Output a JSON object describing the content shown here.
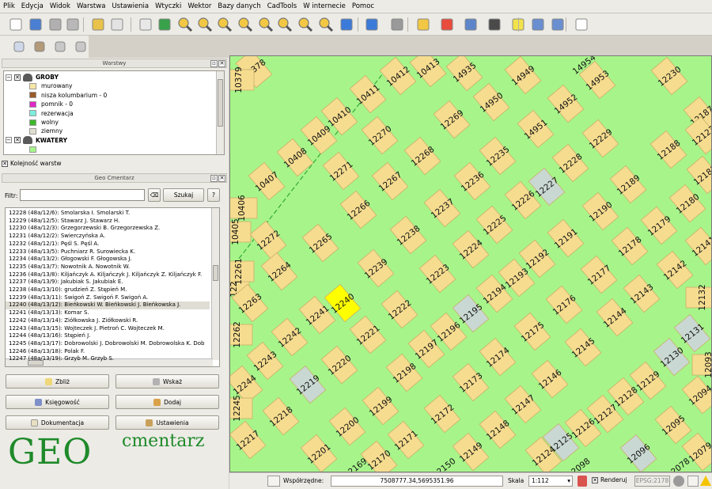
{
  "menu": [
    "Plik",
    "Edycja",
    "Widok",
    "Warstwa",
    "Ustawienia",
    "Wtyczki",
    "Wektor",
    "Bazy danych",
    "CadTools",
    "W internecie",
    "Pomoc"
  ],
  "toolbar": {
    "icons": [
      "new-file-icon",
      "open-project-icon",
      "save-icon",
      "save-as-icon",
      "print-composer-icon",
      "print-icon",
      "pan-hand-icon",
      "pan-to-selection-icon",
      "zoom-in-icon",
      "zoom-out-icon",
      "zoom-native-icon",
      "zoom-full-icon",
      "zoom-layer-icon",
      "zoom-selection-icon",
      "zoom-last-icon",
      "zoom-next-icon",
      "refresh-icon",
      "identify-icon",
      "action-gear-icon",
      "select-features-icon",
      "deselect-icon",
      "attribute-table-icon",
      "measure-icon",
      "map-tips-icon",
      "new-bookmark-icon",
      "show-bookmarks-icon",
      "text-annotation-icon"
    ],
    "row2_icons": [
      "label-abc-icon",
      "label-pin-icon",
      "label-pin-alt-icon",
      "label-move-icon"
    ]
  },
  "layers_panel": {
    "title": "Warstwy",
    "items": [
      {
        "type": "group",
        "label": "GROBY",
        "checked": true
      },
      {
        "type": "class",
        "label": "murowany",
        "color": "#f7e7a5"
      },
      {
        "type": "class",
        "label": "nisza kolumbarium - 0",
        "color": "#9b5a2a"
      },
      {
        "type": "class",
        "label": "pomnik - 0",
        "color": "#e026c6"
      },
      {
        "type": "class",
        "label": "rezerwacja",
        "color": "#7deedd"
      },
      {
        "type": "class",
        "label": "wolny",
        "color": "#3db82b"
      },
      {
        "type": "class",
        "label": "ziemny",
        "color": "#e0dfcf"
      },
      {
        "type": "group",
        "label": "KWATERY",
        "checked": true
      },
      {
        "type": "class",
        "label": "",
        "color": "#a7f58a"
      }
    ],
    "order_checkbox": "Kolejność warstw"
  },
  "geo_panel": {
    "title": "Geo Cmentarz",
    "filter_label": "Filtr:",
    "filter_value": "",
    "search_button": "Szukaj",
    "rows": [
      "12228 (48a/12/6): Smolarska I.  Smolarski T.",
      "12229 (48a/12/5): Stawarz J.  Stawarz H.",
      "12230 (48a/12/3): Grzegorzewski B.  Grzegorzewska Z.",
      "12231 (48a/12/2): Świerczyńska A.",
      "12232 (48a/12/1): Pęśl S.  Pęśl A.",
      "12233 (48a/13/5): Puchniarz R.  Surowiecka K.",
      "12234 (48a/13/2): Głogowski F.  Głogowska J.",
      "12235 (48a/13/7): Nowotnik A.  Nowotnik W.",
      "12236 (48a/13/8): Kiljańczyk A.  Kiljańczyk J.  Kiljańczyk Z.  Kiljańczyk F.",
      "12237 (48a/13/9): Jakubiak S.  Jakubiak E.",
      "12238 (48a/13/10): grudzień Z.  Stępień M.",
      "12239 (48a/13/11): Świgoń Z.  Świgoń F.  Świgoń A.",
      "12240 (48a/13/12): Bieńkowski W.  Bieńkowski J.  Bieńkowska J.",
      "12241 (48a/13/13): Komar S.",
      "12242 (48a/13/14): Ziółkowska J.  Ziółkowski R.",
      "12243 (48a/13/15): Wojteczek J.  Pietroń C.  Wojteczek M.",
      "12244 (48a/13/16): Stępień J.",
      "12245 (48a/13/17): Dobrowolski J.  Dobrowolski M.  Dobrowolska K.  Dob",
      "12246 (48a/13/18): Polak F.",
      "12247 (48a/13/19): Grzyb M.  Grzyb S."
    ],
    "selected_row": 12,
    "buttons": {
      "zoom": "Zbliż",
      "show": "Wskaż",
      "accounting": "Księgowość",
      "add": "Dodaj",
      "docs": "Dokumentacja",
      "settings": "Ustawienia"
    }
  },
  "logo": {
    "big": "GEO",
    "small": "cmentarz"
  },
  "map": {
    "labels": [
      "14954",
      "10378",
      "10379",
      "10412",
      "10411",
      "10413",
      "10410",
      "10409",
      "10408",
      "10407",
      "10406",
      "10405",
      "12273",
      "12272",
      "12271",
      "12270",
      "12269",
      "12268",
      "12267",
      "12266",
      "12265",
      "12264",
      "12263",
      "12262",
      "12261",
      "12240",
      "12241",
      "12242",
      "12243",
      "12244",
      "12245",
      "12217",
      "12218",
      "12219",
      "12220",
      "12221",
      "12222",
      "12223",
      "12224",
      "12225",
      "12226",
      "12227",
      "12228",
      "12229",
      "12230",
      "12235",
      "12236",
      "12237",
      "12238",
      "12239",
      "12199",
      "12198",
      "12197",
      "12196",
      "12195",
      "12194",
      "12193",
      "12192",
      "12191",
      "12190",
      "12189",
      "12188",
      "12187",
      "12181",
      "12180",
      "12179",
      "12178",
      "12177",
      "12176",
      "12175",
      "12174",
      "12173",
      "12172",
      "12171",
      "12170",
      "12169",
      "12150",
      "12149",
      "12148",
      "12147",
      "12146",
      "12145",
      "12144",
      "12143",
      "12142",
      "12141",
      "12132",
      "12131",
      "12130",
      "12129",
      "12128",
      "12127",
      "12126",
      "12125",
      "12124",
      "12098",
      "12096",
      "12095",
      "12094",
      "12093",
      "12079",
      "12078",
      "14935",
      "14949",
      "14950",
      "14951",
      "14952",
      "14953",
      "12201",
      "12200",
      "12123"
    ]
  },
  "status": {
    "coords_label": "Współrzędne:",
    "coords": "7508777.34,5695351.96",
    "scale_label": "Skala",
    "scale": "1:112",
    "render_label": "Renderuj",
    "epsg": "EPSG:2178"
  }
}
